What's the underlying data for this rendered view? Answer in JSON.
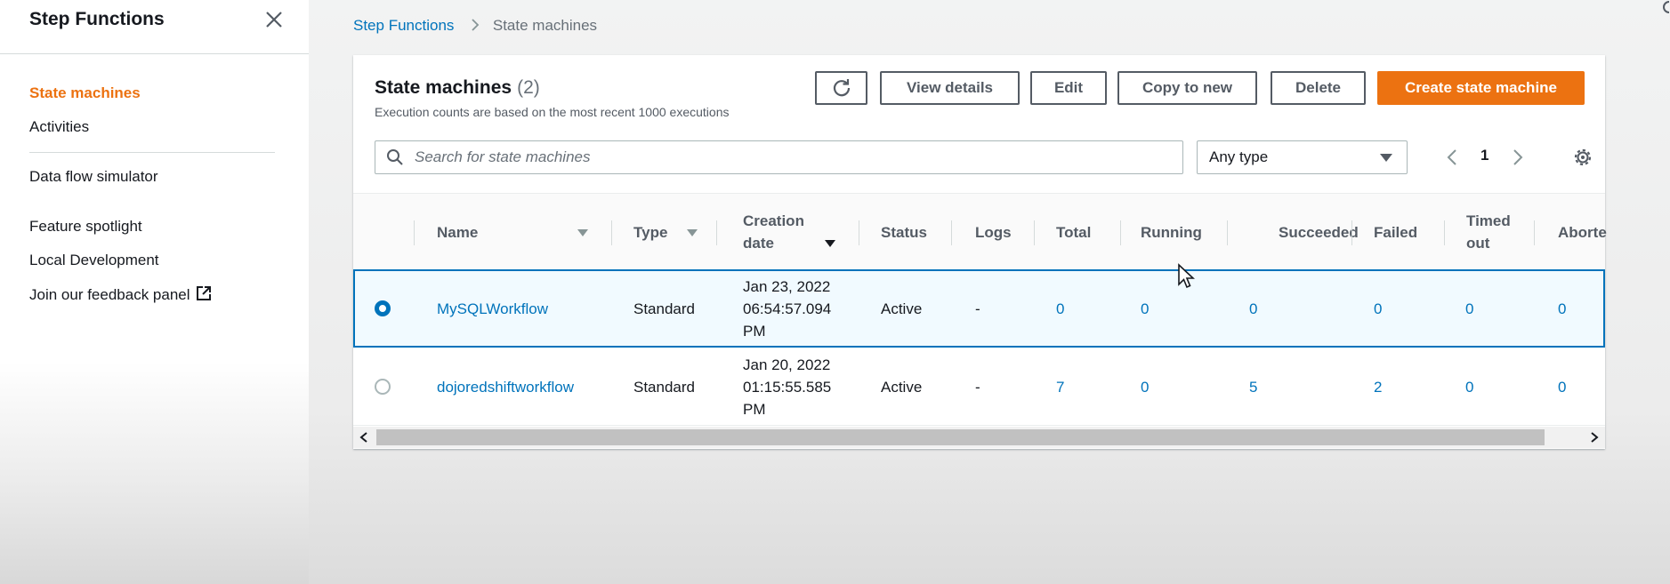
{
  "sidenav": {
    "title": "Step Functions",
    "items": [
      {
        "label": "State machines",
        "active": true
      },
      {
        "label": "Activities"
      },
      {
        "label": "Data flow simulator"
      },
      {
        "label": "Feature spotlight"
      },
      {
        "label": "Local Development"
      },
      {
        "label": "Join our feedback panel",
        "icon": "external-link-icon"
      }
    ]
  },
  "breadcrumb": {
    "items": [
      "Step Functions",
      "State machines"
    ]
  },
  "panel": {
    "title": "State machines",
    "count": "(2)",
    "description": "Execution counts are based on the most recent 1000 executions",
    "buttons": {
      "refresh_icon": "refresh-icon",
      "view_details": "View details",
      "edit": "Edit",
      "copy_to_new": "Copy to new",
      "delete": "Delete",
      "create": "Create state machine"
    },
    "search_placeholder": "Search for state machines",
    "type_filter": "Any type",
    "page": "1"
  },
  "table": {
    "columns": {
      "name": "Name",
      "type": "Type",
      "creation_date": [
        "Creation",
        "date"
      ],
      "status": "Status",
      "logs": "Logs",
      "total": "Total",
      "running": "Running",
      "succeeded": "Succeeded",
      "failed": "Failed",
      "timed_out": [
        "Timed",
        "out"
      ],
      "aborted": "Aborte"
    },
    "rows": [
      {
        "selected": true,
        "name": "MySQLWorkflow",
        "type": "Standard",
        "creation_date": [
          "Jan 23, 2022",
          "06:54:57.094",
          "PM"
        ],
        "status": "Active",
        "logs": "-",
        "total": "0",
        "running": "0",
        "succeeded": "0",
        "failed": "0",
        "timed_out": "0",
        "aborted": "0"
      },
      {
        "selected": false,
        "name": "dojoredshiftworkflow",
        "type": "Standard",
        "creation_date": [
          "Jan 20, 2022",
          "01:15:55.585",
          "PM"
        ],
        "status": "Active",
        "logs": "-",
        "total": "7",
        "running": "0",
        "succeeded": "5",
        "failed": "2",
        "timed_out": "0",
        "aborted": "0"
      }
    ]
  },
  "colors": {
    "accent": "#ec7211",
    "link": "#0073bb",
    "text": "#16191f",
    "muted": "#687078"
  }
}
